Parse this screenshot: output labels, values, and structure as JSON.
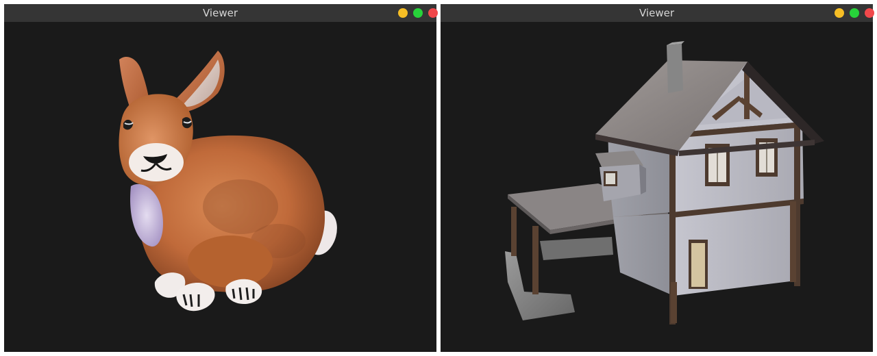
{
  "windows": [
    {
      "title": "Viewer",
      "model": "bunny-model",
      "buttons": {
        "minimize_color": "#f6be25",
        "maximize_color": "#27d33a",
        "close_color": "#f1484b"
      }
    },
    {
      "title": "Viewer",
      "model": "house-model",
      "buttons": {
        "minimize_color": "#f6be25",
        "maximize_color": "#27d33a",
        "close_color": "#f1484b"
      }
    }
  ],
  "colors": {
    "titlebar_bg": "#353535",
    "titlebar_text": "#d6d6d6",
    "viewport_bg": "#1a1a1a"
  }
}
